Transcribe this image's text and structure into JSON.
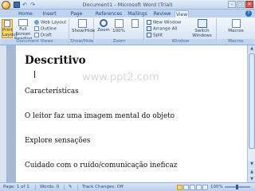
{
  "window": {
    "title": "Document1 - Microsoft Word (Trial)",
    "minimize": "–",
    "maximize": "□",
    "close": "✕"
  },
  "quick_access": {
    "undo": "↶",
    "redo": "↷"
  },
  "tabs": [
    {
      "label": "Home"
    },
    {
      "label": "Insert"
    },
    {
      "label": "Page Layout"
    },
    {
      "label": "References"
    },
    {
      "label": "Mailings"
    },
    {
      "label": "Review"
    },
    {
      "label": "View",
      "active": true
    }
  ],
  "help": "?",
  "ribbon": {
    "views_group": {
      "label": "Document Views",
      "print_layout": "Print Layout",
      "full_screen_reading": "Full Screen Reading",
      "web_layout": "Web Layout",
      "outline": "Outline",
      "draft": "Draft"
    },
    "show_hide_group": {
      "label": "Show/Hide",
      "button": "Show/Hide"
    },
    "zoom_group": {
      "label": "Zoom",
      "zoom": "Zoom",
      "percent": "100%"
    },
    "window_group": {
      "label": "Window",
      "new_window": "New Window",
      "arrange_all": "Arrange All",
      "split": "Split",
      "switch_windows": "Switch Windows"
    },
    "macros_group": {
      "label": "Macros",
      "macros": "Macros"
    }
  },
  "document": {
    "watermark": "www.ppt2.com",
    "title": "Descritivo",
    "paragraphs": [
      "Características",
      "O leitor faz uma imagem mental do objeto",
      "Explore sensações",
      "Cuidado com o ruído/comunicação ineficaz"
    ]
  },
  "statusbar": {
    "page": "Page: 1 of 1",
    "words": "Words: 0",
    "track_changes": "Track Changes: Off",
    "zoom": "100%"
  },
  "colors": {
    "ribbon": "#dbe7f6",
    "tab_bar": "#bfd3ef",
    "doc_background": "#a6b9d3",
    "page": "#ffffff"
  }
}
